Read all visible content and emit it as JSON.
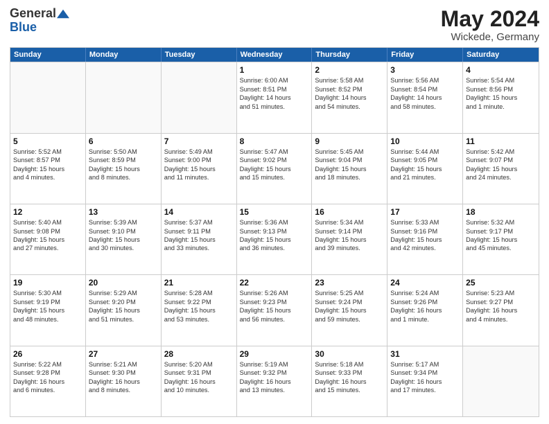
{
  "header": {
    "logo_line1": "General",
    "logo_line2": "Blue",
    "month": "May 2024",
    "location": "Wickede, Germany"
  },
  "weekdays": [
    "Sunday",
    "Monday",
    "Tuesday",
    "Wednesday",
    "Thursday",
    "Friday",
    "Saturday"
  ],
  "weeks": [
    [
      {
        "day": "",
        "text": "",
        "empty": true
      },
      {
        "day": "",
        "text": "",
        "empty": true
      },
      {
        "day": "",
        "text": "",
        "empty": true
      },
      {
        "day": "1",
        "text": "Sunrise: 6:00 AM\nSunset: 8:51 PM\nDaylight: 14 hours\nand 51 minutes.",
        "empty": false
      },
      {
        "day": "2",
        "text": "Sunrise: 5:58 AM\nSunset: 8:52 PM\nDaylight: 14 hours\nand 54 minutes.",
        "empty": false
      },
      {
        "day": "3",
        "text": "Sunrise: 5:56 AM\nSunset: 8:54 PM\nDaylight: 14 hours\nand 58 minutes.",
        "empty": false
      },
      {
        "day": "4",
        "text": "Sunrise: 5:54 AM\nSunset: 8:56 PM\nDaylight: 15 hours\nand 1 minute.",
        "empty": false
      }
    ],
    [
      {
        "day": "5",
        "text": "Sunrise: 5:52 AM\nSunset: 8:57 PM\nDaylight: 15 hours\nand 4 minutes.",
        "empty": false
      },
      {
        "day": "6",
        "text": "Sunrise: 5:50 AM\nSunset: 8:59 PM\nDaylight: 15 hours\nand 8 minutes.",
        "empty": false
      },
      {
        "day": "7",
        "text": "Sunrise: 5:49 AM\nSunset: 9:00 PM\nDaylight: 15 hours\nand 11 minutes.",
        "empty": false
      },
      {
        "day": "8",
        "text": "Sunrise: 5:47 AM\nSunset: 9:02 PM\nDaylight: 15 hours\nand 15 minutes.",
        "empty": false
      },
      {
        "day": "9",
        "text": "Sunrise: 5:45 AM\nSunset: 9:04 PM\nDaylight: 15 hours\nand 18 minutes.",
        "empty": false
      },
      {
        "day": "10",
        "text": "Sunrise: 5:44 AM\nSunset: 9:05 PM\nDaylight: 15 hours\nand 21 minutes.",
        "empty": false
      },
      {
        "day": "11",
        "text": "Sunrise: 5:42 AM\nSunset: 9:07 PM\nDaylight: 15 hours\nand 24 minutes.",
        "empty": false
      }
    ],
    [
      {
        "day": "12",
        "text": "Sunrise: 5:40 AM\nSunset: 9:08 PM\nDaylight: 15 hours\nand 27 minutes.",
        "empty": false
      },
      {
        "day": "13",
        "text": "Sunrise: 5:39 AM\nSunset: 9:10 PM\nDaylight: 15 hours\nand 30 minutes.",
        "empty": false
      },
      {
        "day": "14",
        "text": "Sunrise: 5:37 AM\nSunset: 9:11 PM\nDaylight: 15 hours\nand 33 minutes.",
        "empty": false
      },
      {
        "day": "15",
        "text": "Sunrise: 5:36 AM\nSunset: 9:13 PM\nDaylight: 15 hours\nand 36 minutes.",
        "empty": false
      },
      {
        "day": "16",
        "text": "Sunrise: 5:34 AM\nSunset: 9:14 PM\nDaylight: 15 hours\nand 39 minutes.",
        "empty": false
      },
      {
        "day": "17",
        "text": "Sunrise: 5:33 AM\nSunset: 9:16 PM\nDaylight: 15 hours\nand 42 minutes.",
        "empty": false
      },
      {
        "day": "18",
        "text": "Sunrise: 5:32 AM\nSunset: 9:17 PM\nDaylight: 15 hours\nand 45 minutes.",
        "empty": false
      }
    ],
    [
      {
        "day": "19",
        "text": "Sunrise: 5:30 AM\nSunset: 9:19 PM\nDaylight: 15 hours\nand 48 minutes.",
        "empty": false
      },
      {
        "day": "20",
        "text": "Sunrise: 5:29 AM\nSunset: 9:20 PM\nDaylight: 15 hours\nand 51 minutes.",
        "empty": false
      },
      {
        "day": "21",
        "text": "Sunrise: 5:28 AM\nSunset: 9:22 PM\nDaylight: 15 hours\nand 53 minutes.",
        "empty": false
      },
      {
        "day": "22",
        "text": "Sunrise: 5:26 AM\nSunset: 9:23 PM\nDaylight: 15 hours\nand 56 minutes.",
        "empty": false
      },
      {
        "day": "23",
        "text": "Sunrise: 5:25 AM\nSunset: 9:24 PM\nDaylight: 15 hours\nand 59 minutes.",
        "empty": false
      },
      {
        "day": "24",
        "text": "Sunrise: 5:24 AM\nSunset: 9:26 PM\nDaylight: 16 hours\nand 1 minute.",
        "empty": false
      },
      {
        "day": "25",
        "text": "Sunrise: 5:23 AM\nSunset: 9:27 PM\nDaylight: 16 hours\nand 4 minutes.",
        "empty": false
      }
    ],
    [
      {
        "day": "26",
        "text": "Sunrise: 5:22 AM\nSunset: 9:28 PM\nDaylight: 16 hours\nand 6 minutes.",
        "empty": false
      },
      {
        "day": "27",
        "text": "Sunrise: 5:21 AM\nSunset: 9:30 PM\nDaylight: 16 hours\nand 8 minutes.",
        "empty": false
      },
      {
        "day": "28",
        "text": "Sunrise: 5:20 AM\nSunset: 9:31 PM\nDaylight: 16 hours\nand 10 minutes.",
        "empty": false
      },
      {
        "day": "29",
        "text": "Sunrise: 5:19 AM\nSunset: 9:32 PM\nDaylight: 16 hours\nand 13 minutes.",
        "empty": false
      },
      {
        "day": "30",
        "text": "Sunrise: 5:18 AM\nSunset: 9:33 PM\nDaylight: 16 hours\nand 15 minutes.",
        "empty": false
      },
      {
        "day": "31",
        "text": "Sunrise: 5:17 AM\nSunset: 9:34 PM\nDaylight: 16 hours\nand 17 minutes.",
        "empty": false
      },
      {
        "day": "",
        "text": "",
        "empty": true
      }
    ]
  ]
}
